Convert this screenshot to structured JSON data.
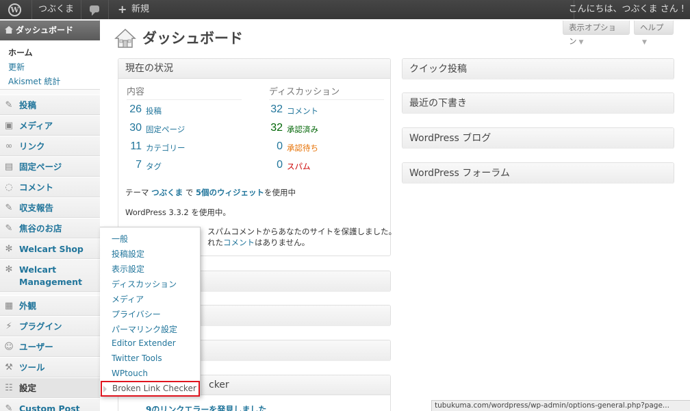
{
  "adminbar": {
    "site_name": "つぶくま",
    "new_label": "新規",
    "greeting": "こんにちは、つぶくま さん !"
  },
  "sidebar": {
    "dashboard": "ダッシュボード",
    "submenu": [
      "ホーム",
      "更新",
      "Akismet 統計"
    ],
    "items": [
      {
        "label": "投稿",
        "icon": "pin-icon"
      },
      {
        "label": "メディア",
        "icon": "media-icon"
      },
      {
        "label": "リンク",
        "icon": "link-icon"
      },
      {
        "label": "固定ページ",
        "icon": "page-icon"
      },
      {
        "label": "コメント",
        "icon": "comment-icon"
      },
      {
        "label": "収支報告",
        "icon": "pin-icon"
      },
      {
        "label": "焦谷のお店",
        "icon": "pin-icon"
      },
      {
        "label": "Welcart Shop",
        "icon": "gear-icon"
      },
      {
        "label": "Welcart Management",
        "icon": "gear-icon"
      },
      {
        "label": "外観",
        "icon": "appearance-icon"
      },
      {
        "label": "プラグイン",
        "icon": "plugin-icon"
      },
      {
        "label": "ユーザー",
        "icon": "users-icon"
      },
      {
        "label": "ツール",
        "icon": "tools-icon"
      },
      {
        "label": "設定",
        "icon": "settings-icon"
      },
      {
        "label": "Custom Post",
        "icon": "pin-icon"
      }
    ]
  },
  "flyout": {
    "items": [
      "一般",
      "投稿設定",
      "表示設定",
      "ディスカッション",
      "メディア",
      "プライバシー",
      "パーマリンク設定",
      "Editor Extender",
      "Twitter Tools",
      "WPtouch"
    ],
    "highlighted": "Broken Link Checker"
  },
  "header": {
    "screen_options": "表示オプション",
    "help": "ヘルプ",
    "title": "ダッシュボード"
  },
  "right_now": {
    "title": "現在の状況",
    "content_head": "内容",
    "discussion_head": "ディスカッション",
    "content": [
      {
        "num": "26",
        "label": "投稿"
      },
      {
        "num": "30",
        "label": "固定ページ"
      },
      {
        "num": "11",
        "label": "カテゴリー"
      },
      {
        "num": "7",
        "label": "タグ"
      }
    ],
    "discussion": [
      {
        "num": "32",
        "label": "コメント"
      },
      {
        "num": "32",
        "label": "承認済み"
      },
      {
        "num": "0",
        "label": "承認待ち"
      },
      {
        "num": "0",
        "label": "スパム"
      }
    ],
    "theme_prefix": "テーマ",
    "theme_name": "つぶくま",
    "theme_mid": "で",
    "widgets": "5個のウィジェット",
    "theme_suffix": "を使用中",
    "version_text": "WordPress 3.3.2 を使用中。",
    "akismet_line1": "スパムコメントからあなたのサイトを保護しました。",
    "akismet_line2a": "れた",
    "akismet_link": "コメント",
    "akismet_line2b": "はありません。"
  },
  "side_boxes": [
    "クイック投稿",
    "最近の下書き",
    "WordPress ブログ",
    "WordPress フォーラム"
  ],
  "lower_left": {
    "blc_title": "cker",
    "blc_notice": "9のリンクエラーを発見しました"
  },
  "statusbar": "tubukuma.com/wordpress/wp-admin/options-general.php?page..."
}
